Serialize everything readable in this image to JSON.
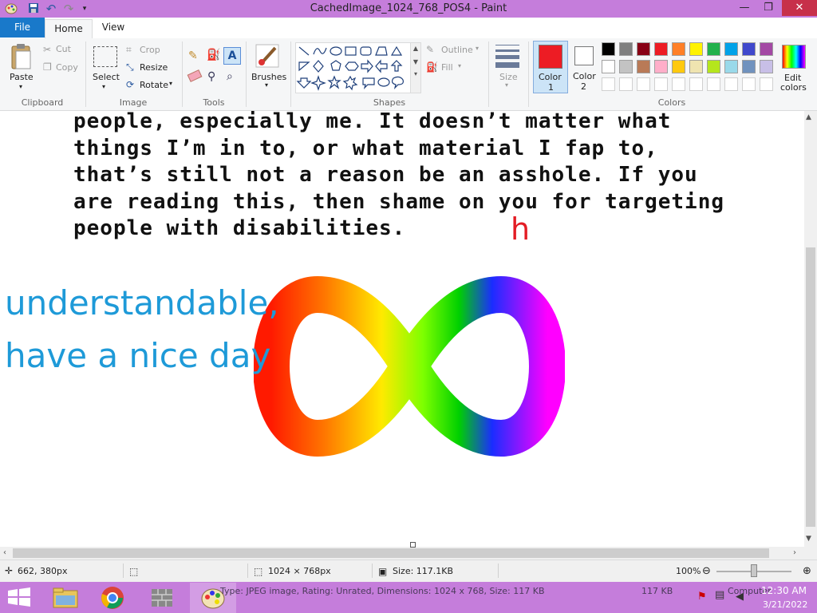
{
  "window": {
    "title": "CachedImage_1024_768_POS4 - Paint",
    "minimize_glyph": "—",
    "maximize_glyph": "❐",
    "close_glyph": "✕"
  },
  "tabs": {
    "file": "File",
    "home": "Home",
    "view": "View"
  },
  "ribbon": {
    "clipboard": {
      "paste": "Paste",
      "cut": "Cut",
      "copy": "Copy",
      "group": "Clipboard"
    },
    "image": {
      "select": "Select",
      "crop": "Crop",
      "resize": "Resize",
      "rotate": "Rotate",
      "group": "Image"
    },
    "tools": {
      "group": "Tools"
    },
    "brushes": "Brushes",
    "shapes": {
      "outline": "Outline",
      "fill": "Fill",
      "group": "Shapes"
    },
    "size": "Size",
    "color1": {
      "line1": "Color",
      "line2": "1",
      "value": "#ed1c24"
    },
    "color2": {
      "line1": "Color",
      "line2": "2",
      "value": "#ffffff"
    },
    "colors_group": "Colors",
    "edit_colors_line1": "Edit",
    "edit_colors_line2": "colors",
    "palette_row1": [
      "#000000",
      "#7f7f7f",
      "#880015",
      "#ed1c24",
      "#ff7f27",
      "#fff200",
      "#22b14c",
      "#00a2e8",
      "#3f48cc",
      "#a349a4"
    ],
    "palette_row2": [
      "#ffffff",
      "#c3c3c3",
      "#b97a57",
      "#ffaec9",
      "#ffc90e",
      "#efe4b0",
      "#b5e61d",
      "#99d9ea",
      "#7092be",
      "#c8bfe7"
    ]
  },
  "canvas": {
    "text_lines": [
      "people, especially me. It doesn’t matter what",
      "things I’m in to, or what material I fap to,",
      "that’s still not a reason be an asshole. If you",
      "are reading this, then shame on you for targeting",
      "people with disabilities."
    ],
    "red_h": "h",
    "blue_line1": "understandable,",
    "blue_line2": "have a nice day"
  },
  "statusbar": {
    "cursor_pos": "662, 380px",
    "dimensions": "1024 × 768px",
    "size": "Size: 117.1KB",
    "zoom": "100%",
    "zoom_level": 1.0
  },
  "taskbar": {
    "tooltip": "Type: JPEG image, Rating: Unrated, Dimensions: 1024 x 768, Size: 117 KB",
    "size_col": "117 KB",
    "computer": "Computer",
    "time": "12:30 AM",
    "date": "3/21/2022"
  }
}
